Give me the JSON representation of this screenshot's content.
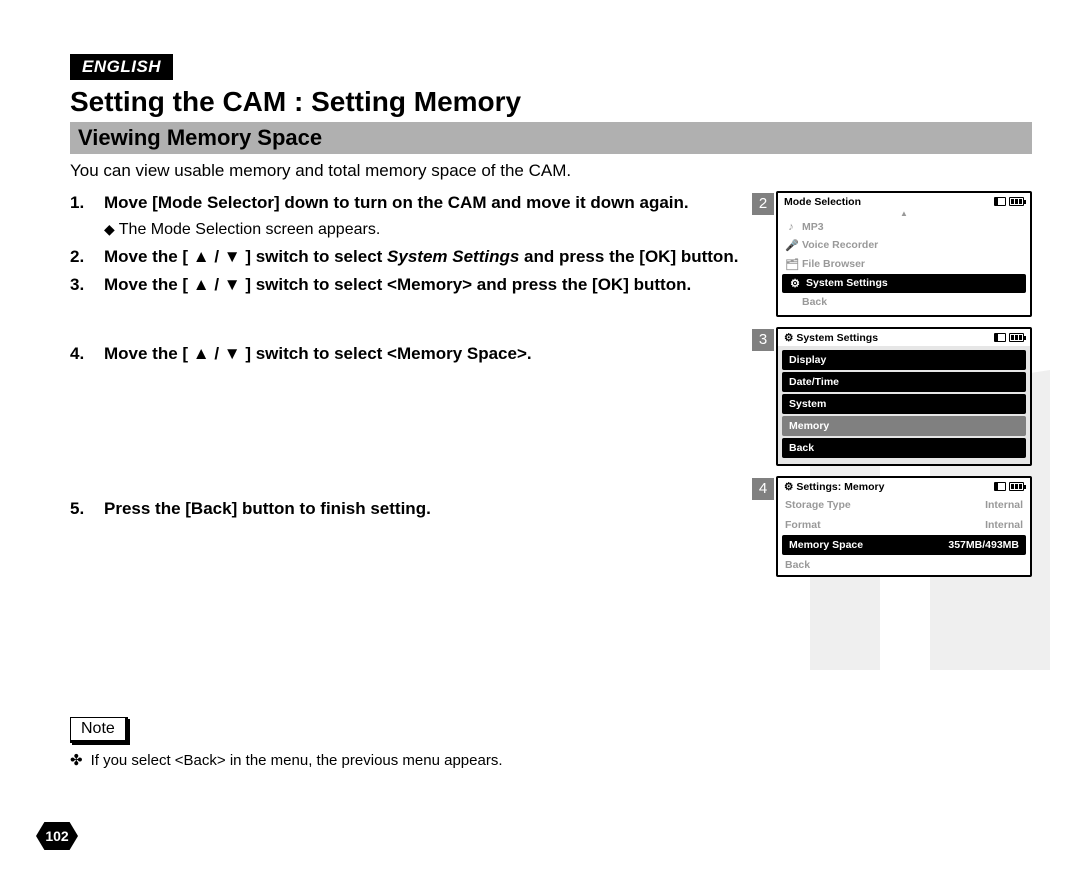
{
  "lang_badge": "ENGLISH",
  "title": "Setting the CAM : Setting Memory",
  "subtitle": "Viewing Memory Space",
  "intro": "You can view usable memory and total memory space of the CAM.",
  "steps": {
    "s1": {
      "num": "1.",
      "main": "Move [Mode Selector] down to turn on the CAM and move it down again.",
      "sub": "The Mode Selection screen appears."
    },
    "s2": {
      "num": "2.",
      "pre": "Move the [ ▲ / ▼ ] switch to select ",
      "em": "System Settings",
      "post": " and press the [OK] button."
    },
    "s3": {
      "num": "3.",
      "main": "Move the [ ▲ / ▼ ] switch to select <Memory> and press the [OK] button."
    },
    "s4": {
      "num": "4.",
      "main": "Move the [ ▲ / ▼ ] switch to select <Memory Space>."
    },
    "s5": {
      "num": "5.",
      "main": "Press the [Back] button to finish setting."
    }
  },
  "screens": {
    "s2": {
      "num": "2",
      "title": "Mode Selection",
      "items": [
        {
          "icon": "♪",
          "label": "MP3"
        },
        {
          "icon": "🎤",
          "label": "Voice Recorder"
        },
        {
          "icon": "🗂",
          "label": "File Browser"
        },
        {
          "icon": "⚙",
          "label": "System Settings",
          "selected": true
        },
        {
          "icon": "",
          "label": "Back"
        }
      ]
    },
    "s3": {
      "num": "3",
      "title_icon": "⚙",
      "title": "System Settings",
      "stack": [
        {
          "label": "Display"
        },
        {
          "label": "Date/Time"
        },
        {
          "label": "System"
        },
        {
          "label": "Memory",
          "selected": true
        },
        {
          "label": "Back"
        }
      ]
    },
    "s4": {
      "num": "4",
      "title_icon": "⚙",
      "title": "Settings: Memory",
      "rows": [
        {
          "label": "Storage Type",
          "value": "Internal"
        },
        {
          "label": "Format",
          "value": "Internal"
        },
        {
          "label": "Memory Space",
          "value": "357MB/493MB",
          "selected": true
        },
        {
          "label": "Back",
          "value": ""
        }
      ]
    }
  },
  "note_box": "Note",
  "note_line": "If you select <Back> in the menu, the previous menu appears.",
  "page_number": "102"
}
